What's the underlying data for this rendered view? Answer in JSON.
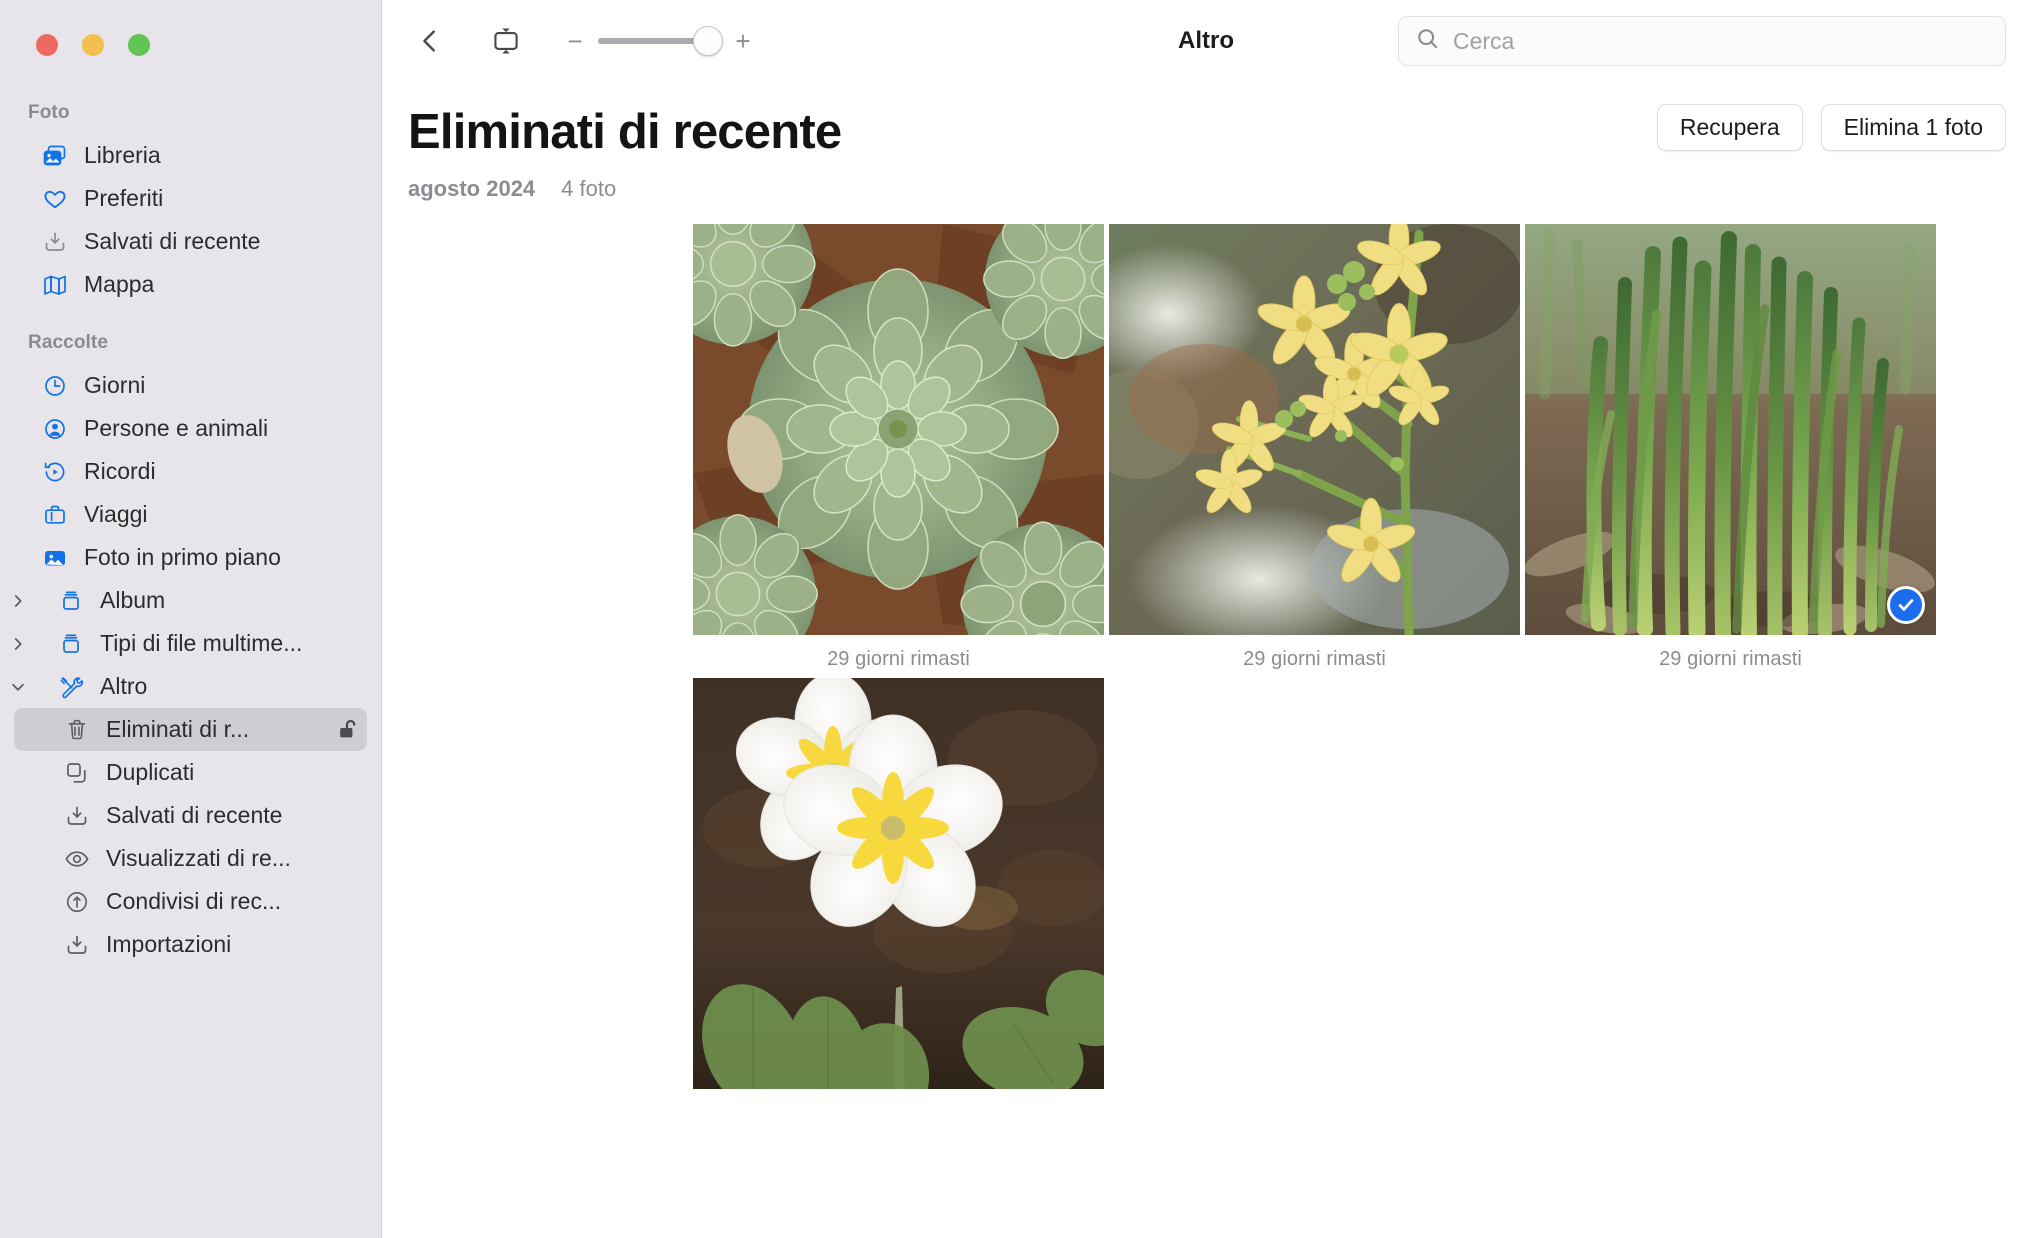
{
  "window": {
    "traffic_lights": [
      "close",
      "minimize",
      "maximize"
    ],
    "colors": {
      "close": "#ec6a5f",
      "minimize": "#f3c04f",
      "maximize": "#61c454",
      "accent": "#1a6ded",
      "sidebar_bg": "#e7e5e9",
      "selected_bg": "#cfcdd1"
    }
  },
  "sidebar": {
    "groups": [
      {
        "title": "Foto",
        "items": [
          {
            "label": "Libreria",
            "icon": "photo-library-icon"
          },
          {
            "label": "Preferiti",
            "icon": "heart-icon"
          },
          {
            "label": "Salvati di recente",
            "icon": "tray-download-icon"
          },
          {
            "label": "Mappa",
            "icon": "map-icon"
          }
        ]
      },
      {
        "title": "Raccolte",
        "items": [
          {
            "label": "Giorni",
            "icon": "clock-icon"
          },
          {
            "label": "Persone e animali",
            "icon": "person-circle-icon"
          },
          {
            "label": "Ricordi",
            "icon": "memories-play-icon"
          },
          {
            "label": "Viaggi",
            "icon": "suitcase-icon"
          },
          {
            "label": "Foto in primo piano",
            "icon": "featured-photo-icon"
          },
          {
            "label": "Album",
            "icon": "album-box-icon",
            "disclosure": "collapsed"
          },
          {
            "label": "Tipi di file multime...",
            "icon": "album-box-icon",
            "disclosure": "collapsed"
          },
          {
            "label": "Altro",
            "icon": "tools-icon",
            "disclosure": "expanded"
          },
          {
            "label": "Eliminati di r...",
            "icon": "trash-icon",
            "sub": true,
            "selected": true,
            "trailing_icon": "unlocked-padlock-icon"
          },
          {
            "label": "Duplicati",
            "icon": "duplicate-icon",
            "sub": true
          },
          {
            "label": "Salvati di recente",
            "icon": "tray-download-icon-gray",
            "sub": true
          },
          {
            "label": "Visualizzati di re...",
            "icon": "eye-icon",
            "sub": true
          },
          {
            "label": "Condivisi di rec...",
            "icon": "share-circle-icon",
            "sub": true
          },
          {
            "label": "Importazioni",
            "icon": "tray-download-icon-gray",
            "sub": true
          }
        ]
      }
    ]
  },
  "toolbar": {
    "back_icon": "chevron-left-icon",
    "aspect_icon": "aspect-ratio-icon",
    "zoom_minus": "−",
    "zoom_plus": "+",
    "zoom_value": 100,
    "title": "Altro",
    "search": {
      "placeholder": "Cerca",
      "value": "",
      "icon": "search-icon"
    }
  },
  "content": {
    "page_title": "Eliminati di recente",
    "date": "agosto 2024",
    "count": "4 foto",
    "actions": [
      {
        "label": "Recupera",
        "name": "recover-button"
      },
      {
        "label": "Elimina 1 foto",
        "name": "delete-button"
      }
    ],
    "photos": [
      {
        "caption": "29 giorni rimasti",
        "alt": "succulent-rosettes",
        "selected": false
      },
      {
        "caption": "29 giorni rimasti",
        "alt": "yellow-flowers",
        "selected": false
      },
      {
        "caption": "29 giorni rimasti",
        "alt": "green-chives",
        "selected": true
      },
      {
        "caption": "",
        "alt": "white-primrose",
        "selected": false
      }
    ]
  }
}
